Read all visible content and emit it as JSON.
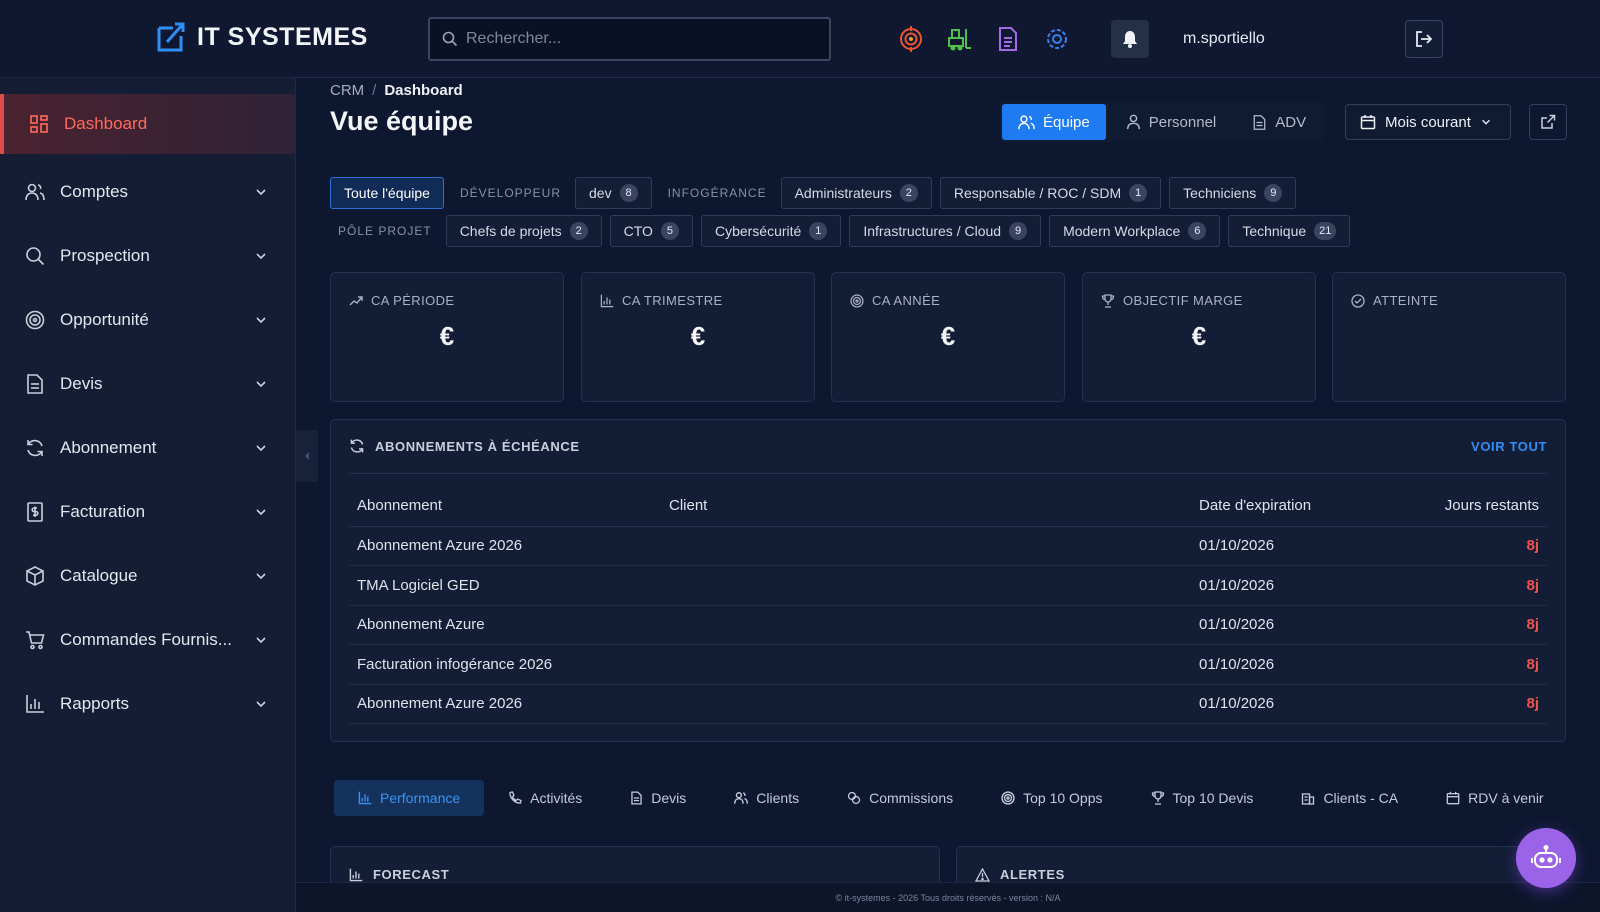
{
  "brand": {
    "name": "IT SYSTEMES"
  },
  "search": {
    "placeholder": "Rechercher..."
  },
  "header": {
    "icons": [
      "target-icon",
      "forklift-icon",
      "document-icon",
      "cog-network-icon"
    ],
    "username": "m.sportiello"
  },
  "sidebar": {
    "items": [
      {
        "label": "Dashboard",
        "icon": "grid-icon",
        "active": true
      },
      {
        "label": "Comptes",
        "icon": "users-icon"
      },
      {
        "label": "Prospection",
        "icon": "search-icon"
      },
      {
        "label": "Opportunité",
        "icon": "target-icon"
      },
      {
        "label": "Devis",
        "icon": "document-icon"
      },
      {
        "label": "Abonnement",
        "icon": "refresh-icon"
      },
      {
        "label": "Facturation",
        "icon": "invoice-icon"
      },
      {
        "label": "Catalogue",
        "icon": "box-icon"
      },
      {
        "label": "Commandes Fournis...",
        "icon": "cart-icon"
      },
      {
        "label": "Rapports",
        "icon": "bar-chart-icon"
      }
    ]
  },
  "breadcrumb": {
    "root": "CRM",
    "current": "Dashboard"
  },
  "page": {
    "title": "Vue équipe"
  },
  "views": {
    "equipe": "Équipe",
    "personnel": "Personnel",
    "adv": "ADV"
  },
  "period": {
    "label": "Mois courant"
  },
  "filters": {
    "all": "Toute l'équipe",
    "groups": [
      {
        "label": "DÉVELOPPEUR",
        "chips": [
          {
            "label": "dev",
            "count": "8"
          }
        ]
      },
      {
        "label": "INFOGÉRANCE",
        "chips": [
          {
            "label": "Administrateurs",
            "count": "2"
          },
          {
            "label": "Responsable / ROC / SDM",
            "count": "1"
          },
          {
            "label": "Techniciens",
            "count": "9"
          }
        ]
      },
      {
        "label": "PÔLE PROJET",
        "chips": [
          {
            "label": "Chefs de projets",
            "count": "2"
          },
          {
            "label": "CTO",
            "count": "5"
          },
          {
            "label": "Cybersécurité",
            "count": "1"
          },
          {
            "label": "Infrastructures / Cloud",
            "count": "9"
          },
          {
            "label": "Modern Workplace",
            "count": "6"
          },
          {
            "label": "Technique",
            "count": "21"
          }
        ]
      }
    ]
  },
  "kpis": [
    {
      "label": "CA PÉRIODE",
      "value": "€",
      "icon": "trend-up-icon"
    },
    {
      "label": "CA TRIMESTRE",
      "value": "€",
      "icon": "bar-chart-icon"
    },
    {
      "label": "CA ANNÉE",
      "value": "€",
      "icon": "target-icon"
    },
    {
      "label": "OBJECTIF MARGE",
      "value": "€",
      "icon": "trophy-icon"
    },
    {
      "label": "ATTEINTE",
      "value": "",
      "icon": "check-circle-icon"
    }
  ],
  "subscriptions": {
    "title": "ABONNEMENTS À ÉCHÉANCE",
    "see_all": "VOIR TOUT",
    "columns": [
      "Abonnement",
      "Client",
      "Date d'expiration",
      "Jours restants"
    ],
    "rows": [
      {
        "name": "Abonnement Azure 2026",
        "client": "",
        "date": "01/10/2026",
        "days": "8j"
      },
      {
        "name": "TMA Logiciel GED",
        "client": "",
        "date": "01/10/2026",
        "days": "8j"
      },
      {
        "name": "Abonnement Azure",
        "client": "",
        "date": "01/10/2026",
        "days": "8j"
      },
      {
        "name": "Facturation infogérance 2026",
        "client": "",
        "date": "01/10/2026",
        "days": "8j"
      },
      {
        "name": "Abonnement Azure 2026",
        "client": "",
        "date": "01/10/2026",
        "days": "8j"
      }
    ]
  },
  "tabs": [
    {
      "label": "Performance",
      "icon": "bar-chart-icon",
      "active": true
    },
    {
      "label": "Activités",
      "icon": "phone-icon"
    },
    {
      "label": "Devis",
      "icon": "document-icon"
    },
    {
      "label": "Clients",
      "icon": "users-icon"
    },
    {
      "label": "Commissions",
      "icon": "coins-icon"
    },
    {
      "label": "Top 10 Opps",
      "icon": "target-icon"
    },
    {
      "label": "Top 10 Devis",
      "icon": "trophy-icon"
    },
    {
      "label": "Clients - CA",
      "icon": "building-icon"
    },
    {
      "label": "RDV à venir",
      "icon": "calendar-icon"
    }
  ],
  "forecast": {
    "title": "FORECAST"
  },
  "alerts": {
    "title": "ALERTES"
  },
  "footer": {
    "text": "© it-systemes - 2026 Tous droits réservés - version : N/A"
  },
  "colors": {
    "accent": "#1e7bf2",
    "danger": "#f0524d",
    "bot": "#9a63e8",
    "active_sidebar": "#ff6b5a"
  }
}
